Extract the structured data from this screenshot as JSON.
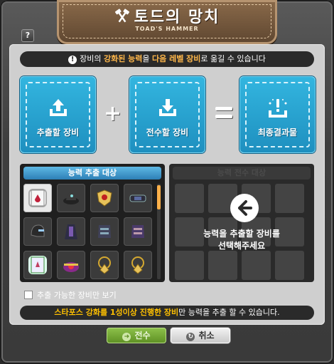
{
  "window": {
    "title": "토드의 망치",
    "subtitle": "TOAD'S HAMMER",
    "help_label": "?"
  },
  "notice": {
    "pre": "장비의 ",
    "hi1": "강화된 능력",
    "mid": "을 ",
    "hi2": "다음 레벨 장비",
    "post": "로 옮길 수 있습니다"
  },
  "steps": {
    "extract_label": "추출할 장비",
    "inherit_label": "전수할 장비",
    "result_label": "최종결과물",
    "plus": "+"
  },
  "left_panel": {
    "header": "능력 추출 대상",
    "items": [
      {
        "icon": "scroll-icon",
        "selected": true
      },
      {
        "icon": "black-hat-icon"
      },
      {
        "icon": "gold-shield-icon"
      },
      {
        "icon": "bracer-icon"
      },
      {
        "icon": "black-helmet-icon"
      },
      {
        "icon": "robe-icon"
      },
      {
        "icon": "armor-icon"
      },
      {
        "icon": "purple-armor-icon"
      },
      {
        "icon": "green-scroll-icon"
      },
      {
        "icon": "jewel-hat-icon"
      },
      {
        "icon": "gold-pendant-icon"
      },
      {
        "icon": "gold-pendant-icon"
      }
    ]
  },
  "right_panel": {
    "header": "능력 전수 대상",
    "message_line1": "능력을 추출할 장비를",
    "message_line2": "선택해주세요"
  },
  "filter": {
    "checkbox_label": "추출 가능한 장비만 보기",
    "checked": false
  },
  "warning": {
    "hi": "스타포스 강화를 1성이상 진행한 장비",
    "post": "만 능력을 추출 할 수 있습니다."
  },
  "buttons": {
    "confirm_label": "전수",
    "cancel_label": "취소"
  },
  "colors": {
    "accent_blue": "#1e8fbf",
    "highlight_orange": "#ffb74a",
    "confirm_green": "#6fa02f"
  }
}
